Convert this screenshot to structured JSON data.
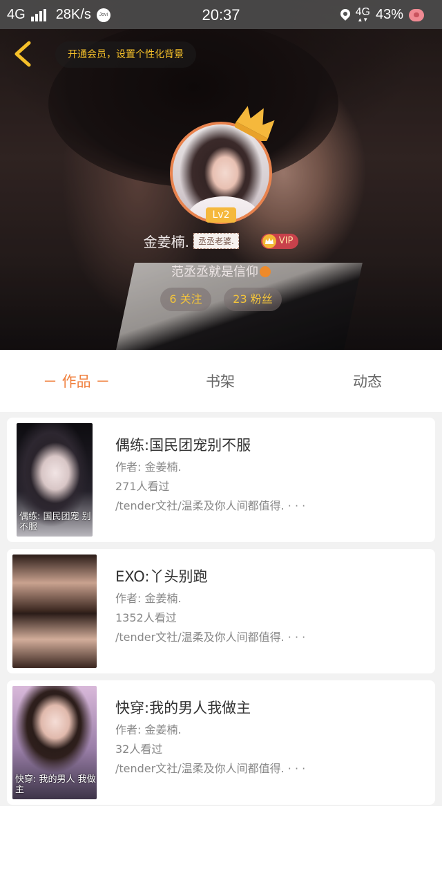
{
  "status_bar": {
    "network": "4G",
    "speed": "28K/s",
    "jovi": "Jovi",
    "time": "20:37",
    "network_right": "4G",
    "battery": "43%"
  },
  "header": {
    "vip_banner": "开通会员，设置个性化背景",
    "level": "Lv2",
    "username": "金姜楠.",
    "title_tag": "丞丞老婆.",
    "vip_label": "VIP",
    "bio": "范丞丞就是信仰",
    "following": "6 关注",
    "followers": "23 粉丝"
  },
  "tabs": [
    {
      "label": "－ 作品 －",
      "active": true
    },
    {
      "label": "书架",
      "active": false
    },
    {
      "label": "动态",
      "active": false
    }
  ],
  "books": [
    {
      "title": "偶练:国民团宠别不服",
      "author": "作者: 金姜楠.",
      "views": "271人看过",
      "tag": "/tender文社/温柔及你人间都值得. · · ·",
      "cover_text": "偶练: 国民团宠 别不服"
    },
    {
      "title": "EXO:丫头别跑",
      "author": "作者: 金姜楠.",
      "views": "1352人看过",
      "tag": "/tender文社/温柔及你人间都值得. · · ·",
      "cover_text": ""
    },
    {
      "title": "快穿:我的男人我做主",
      "author": "作者: 金姜楠.",
      "views": "32人看过",
      "tag": "/tender文社/温柔及你人间都值得. · · ·",
      "cover_text": "快穿: 我的男人 我做主"
    }
  ],
  "colors": {
    "accent_orange": "#f07f3c",
    "gold": "#f3c43b",
    "vip_red": "#c8414b"
  }
}
